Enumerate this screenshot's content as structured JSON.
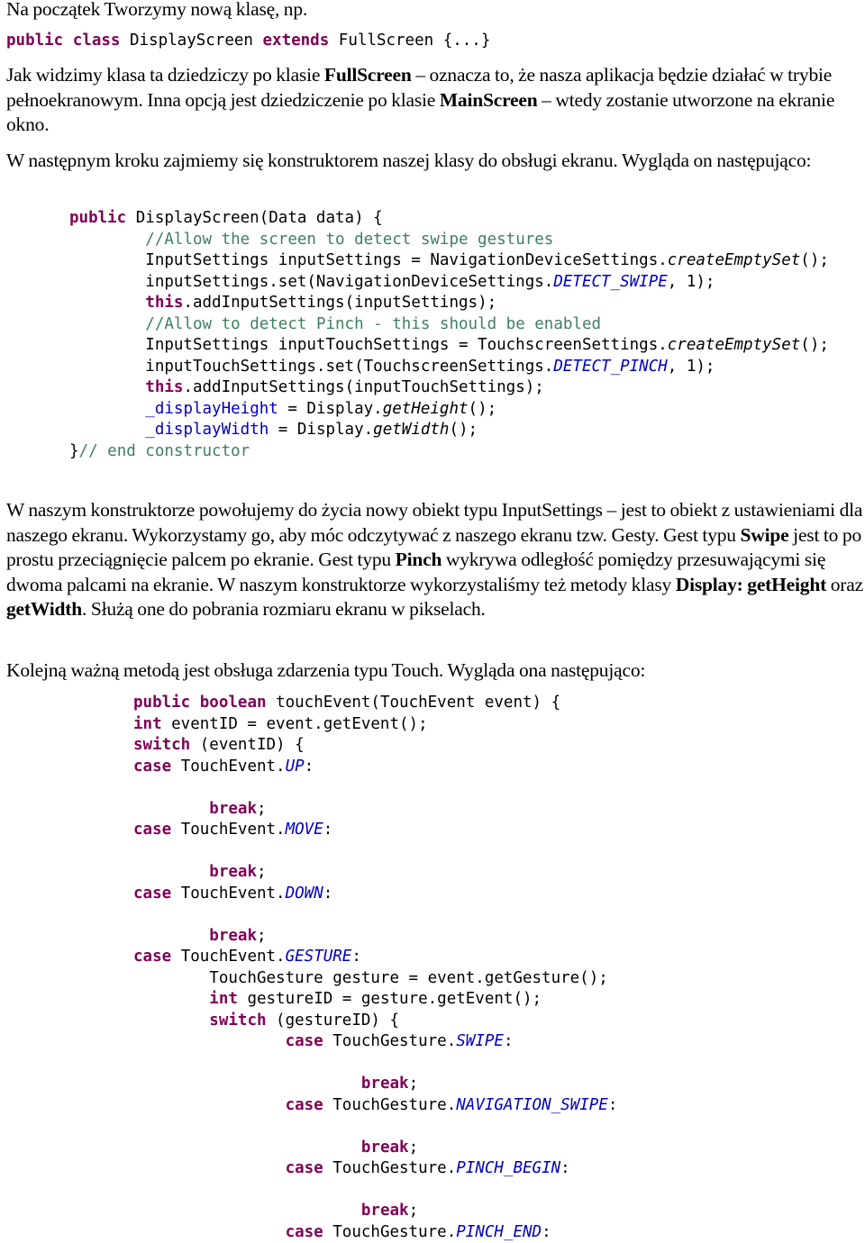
{
  "colors": {
    "keyword": "#7F0055",
    "comment": "#3F7F5F",
    "constant": "#0000C0",
    "text": "#000000",
    "background": "#FFFFFF"
  },
  "intro": {
    "text": "Na początek Tworzymy nową klasę, np."
  },
  "class_decl": [
    {
      "t": "public",
      "c": "kw"
    },
    {
      "t": " "
    },
    {
      "t": "class",
      "c": "kw"
    },
    {
      "t": " DisplayScreen "
    },
    {
      "t": "extends",
      "c": "kw"
    },
    {
      "t": " FullScreen {...}"
    }
  ],
  "para1": [
    {
      "t": "Jak widzimy klasa ta dziedziczy po klasie "
    },
    {
      "t": "FullScreen",
      "b": true
    },
    {
      "t": " – oznacza to, że nasza aplikacja będzie działać w trybie pełnoekranowym. Inna opcją jest dziedziczenie po klasie "
    },
    {
      "t": "MainScreen",
      "b": true
    },
    {
      "t": " – wtedy zostanie utworzone na ekranie okno."
    }
  ],
  "para2": [
    {
      "t": "W następnym kroku zajmiemy się konstruktorem naszej klasy do obsługi ekranu. Wygląda on następująco:"
    }
  ],
  "constructor_code": [
    [
      {
        "t": "public",
        "c": "kw"
      },
      {
        "t": " DisplayScreen(Data data) {"
      }
    ],
    [
      {
        "t": "        "
      },
      {
        "t": "//Allow the screen to detect swipe gestures",
        "c": "cm"
      }
    ],
    [
      {
        "t": "        InputSettings inputSettings = NavigationDeviceSettings."
      },
      {
        "t": "createEmptySet",
        "c": "it"
      },
      {
        "t": "();"
      }
    ],
    [
      {
        "t": "        inputSettings.set(NavigationDeviceSettings."
      },
      {
        "t": "DETECT_SWIPE",
        "c": "cst"
      },
      {
        "t": ", 1);"
      }
    ],
    [
      {
        "t": "        "
      },
      {
        "t": "this",
        "c": "kw"
      },
      {
        "t": ".addInputSettings(inputSettings);"
      }
    ],
    [
      {
        "t": "        "
      },
      {
        "t": "//Allow to detect Pinch - this should be enabled",
        "c": "cm"
      }
    ],
    [
      {
        "t": "        InputSettings inputTouchSettings = TouchscreenSettings."
      },
      {
        "t": "createEmptySet",
        "c": "it"
      },
      {
        "t": "();"
      }
    ],
    [
      {
        "t": "        inputTouchSettings.set(TouchscreenSettings."
      },
      {
        "t": "DETECT_PINCH",
        "c": "cst"
      },
      {
        "t": ", 1);"
      }
    ],
    [
      {
        "t": "        "
      },
      {
        "t": "this",
        "c": "kw"
      },
      {
        "t": ".addInputSettings(inputTouchSettings);"
      }
    ],
    [
      {
        "t": "        "
      },
      {
        "t": "_displayHeight",
        "c": "fld"
      },
      {
        "t": " = Display."
      },
      {
        "t": "getHeight",
        "c": "it"
      },
      {
        "t": "();"
      }
    ],
    [
      {
        "t": "        "
      },
      {
        "t": "_displayWidth",
        "c": "fld"
      },
      {
        "t": " = Display."
      },
      {
        "t": "getWidth",
        "c": "it"
      },
      {
        "t": "();"
      }
    ],
    [
      {
        "t": "}"
      },
      {
        "t": "// end constructor",
        "c": "cm"
      }
    ]
  ],
  "para3": [
    {
      "t": "W naszym konstruktorze powołujemy do życia nowy obiekt typu InputSettings – jest to obiekt z ustawieniami dla naszego ekranu. Wykorzystamy go, aby móc odczytywać z naszego ekranu tzw. Gesty. Gest typu "
    },
    {
      "t": "Swipe",
      "b": true
    },
    {
      "t": " jest to po prostu przeciągnięcie palcem po ekranie. Gest typu "
    },
    {
      "t": "Pinch",
      "b": true
    },
    {
      "t": " wykrywa odległość pomiędzy przesuwającymi się dwoma palcami na ekranie. W naszym konstruktorze wykorzystaliśmy też metody klasy "
    },
    {
      "t": "Display: getHeight",
      "b": true
    },
    {
      "t": " oraz "
    },
    {
      "t": "getWidth",
      "b": true
    },
    {
      "t": ". Służą one do pobrania rozmiaru ekranu w pikselach."
    }
  ],
  "para4": [
    {
      "t": "Kolejną ważną metodą jest obsługa zdarzenia typu Touch. Wygląda ona następująco:"
    }
  ],
  "touch_code": [
    [
      {
        "t": "public",
        "c": "kw"
      },
      {
        "t": " "
      },
      {
        "t": "boolean",
        "c": "kw"
      },
      {
        "t": " touchEvent(TouchEvent event) {"
      }
    ],
    [
      {
        "t": "int",
        "c": "kw"
      },
      {
        "t": " eventID = event.getEvent();"
      }
    ],
    [
      {
        "t": "switch",
        "c": "kw"
      },
      {
        "t": " (eventID) {"
      }
    ],
    [
      {
        "t": "case",
        "c": "kw"
      },
      {
        "t": " TouchEvent."
      },
      {
        "t": "UP",
        "c": "cst"
      },
      {
        "t": ":"
      }
    ],
    [],
    [
      {
        "t": "        "
      },
      {
        "t": "break",
        "c": "kw"
      },
      {
        "t": ";"
      }
    ],
    [
      {
        "t": "case",
        "c": "kw"
      },
      {
        "t": " TouchEvent."
      },
      {
        "t": "MOVE",
        "c": "cst"
      },
      {
        "t": ":"
      }
    ],
    [],
    [
      {
        "t": "        "
      },
      {
        "t": "break",
        "c": "kw"
      },
      {
        "t": ";"
      }
    ],
    [
      {
        "t": "case",
        "c": "kw"
      },
      {
        "t": " TouchEvent."
      },
      {
        "t": "DOWN",
        "c": "cst"
      },
      {
        "t": ":"
      }
    ],
    [],
    [
      {
        "t": "        "
      },
      {
        "t": "break",
        "c": "kw"
      },
      {
        "t": ";"
      }
    ],
    [
      {
        "t": "case",
        "c": "kw"
      },
      {
        "t": " TouchEvent."
      },
      {
        "t": "GESTURE",
        "c": "cst"
      },
      {
        "t": ":"
      }
    ],
    [
      {
        "t": "        TouchGesture gesture = event.getGesture();"
      }
    ],
    [
      {
        "t": "        "
      },
      {
        "t": "int",
        "c": "kw"
      },
      {
        "t": " gestureID = gesture.getEvent();"
      }
    ],
    [
      {
        "t": "        "
      },
      {
        "t": "switch",
        "c": "kw"
      },
      {
        "t": " (gestureID) {"
      }
    ],
    [
      {
        "t": "                "
      },
      {
        "t": "case",
        "c": "kw"
      },
      {
        "t": " TouchGesture."
      },
      {
        "t": "SWIPE",
        "c": "cst"
      },
      {
        "t": ":"
      }
    ],
    [],
    [
      {
        "t": "                        "
      },
      {
        "t": "break",
        "c": "kw"
      },
      {
        "t": ";"
      }
    ],
    [
      {
        "t": "                "
      },
      {
        "t": "case",
        "c": "kw"
      },
      {
        "t": " TouchGesture."
      },
      {
        "t": "NAVIGATION_SWIPE",
        "c": "cst"
      },
      {
        "t": ":"
      }
    ],
    [],
    [
      {
        "t": "                        "
      },
      {
        "t": "break",
        "c": "kw"
      },
      {
        "t": ";"
      }
    ],
    [
      {
        "t": "                "
      },
      {
        "t": "case",
        "c": "kw"
      },
      {
        "t": " TouchGesture."
      },
      {
        "t": "PINCH_BEGIN",
        "c": "cst"
      },
      {
        "t": ":"
      }
    ],
    [],
    [
      {
        "t": "                        "
      },
      {
        "t": "break",
        "c": "kw"
      },
      {
        "t": ";"
      }
    ],
    [
      {
        "t": "                "
      },
      {
        "t": "case",
        "c": "kw"
      },
      {
        "t": " TouchGesture."
      },
      {
        "t": "PINCH_END",
        "c": "cst"
      },
      {
        "t": ":"
      }
    ]
  ]
}
